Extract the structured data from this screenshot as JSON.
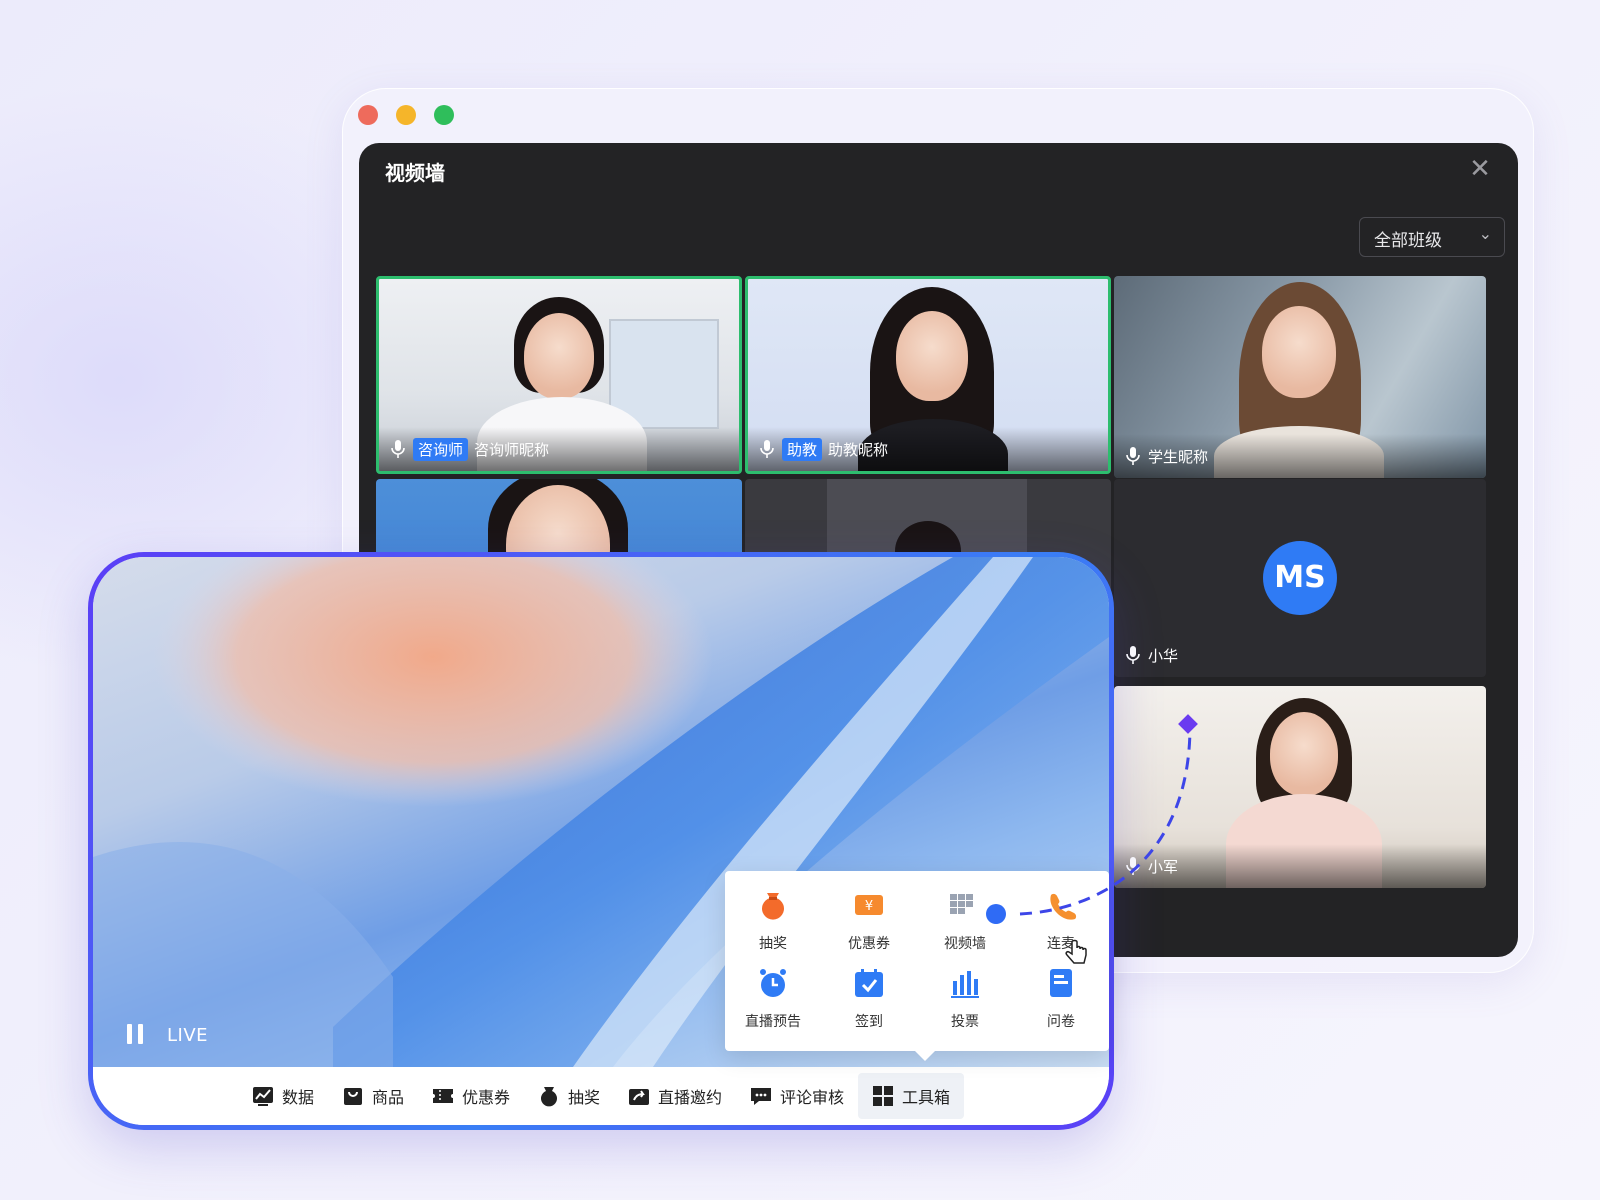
{
  "video_wall": {
    "title": "视频墙",
    "class_filter": "全部班级",
    "tiles": [
      {
        "role": "咨询师",
        "name": "咨询师昵称"
      },
      {
        "role": "助教",
        "name": "助教昵称"
      },
      {
        "role": "",
        "name": "学生昵称"
      },
      {
        "role": "",
        "name": "小华",
        "avatar": "MS"
      },
      {
        "role": "",
        "name": "小军"
      }
    ]
  },
  "player": {
    "status": "LIVE"
  },
  "toolbox": {
    "items": [
      {
        "label": "抽奖",
        "icon": "lottery-bag-icon"
      },
      {
        "label": "优惠券",
        "icon": "coupon-icon"
      },
      {
        "label": "视频墙",
        "icon": "video-wall-icon"
      },
      {
        "label": "连麦",
        "icon": "phone-connect-icon"
      },
      {
        "label": "直播预告",
        "icon": "alarm-clock-icon"
      },
      {
        "label": "签到",
        "icon": "calendar-check-icon"
      },
      {
        "label": "投票",
        "icon": "bar-chart-icon"
      },
      {
        "label": "问卷",
        "icon": "questionnaire-icon"
      }
    ]
  },
  "bottom_bar": {
    "items": [
      {
        "label": "数据",
        "icon": "data-chart-icon"
      },
      {
        "label": "商品",
        "icon": "goods-icon"
      },
      {
        "label": "优惠券",
        "icon": "coupon-icon"
      },
      {
        "label": "抽奖",
        "icon": "lottery-icon"
      },
      {
        "label": "直播邀约",
        "icon": "invite-icon"
      },
      {
        "label": "评论审核",
        "icon": "comment-icon"
      },
      {
        "label": "工具箱",
        "icon": "toolbox-icon"
      }
    ]
  },
  "colors": {
    "accent_blue": "#2f7bf5",
    "active_green": "#2dbd6e",
    "frame_purple": "#5b3ef6"
  }
}
